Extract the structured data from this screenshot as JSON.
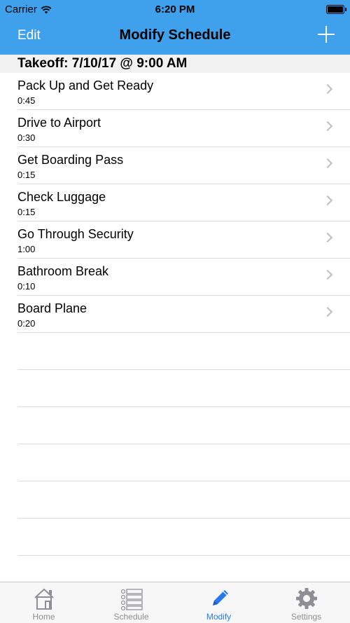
{
  "status": {
    "carrier": "Carrier",
    "time": "6:20 PM"
  },
  "nav": {
    "edit_label": "Edit",
    "title": "Modify Schedule",
    "add_icon": "plus-icon"
  },
  "section": {
    "header": "Takeoff: 7/10/17 @ 9:00 AM"
  },
  "items": [
    {
      "name": "Pack Up and Get Ready",
      "duration": "0:45"
    },
    {
      "name": "Drive to Airport",
      "duration": "0:30"
    },
    {
      "name": "Get Boarding Pass",
      "duration": "0:15"
    },
    {
      "name": "Check Luggage",
      "duration": "0:15"
    },
    {
      "name": "Go Through Security",
      "duration": "1:00"
    },
    {
      "name": "Bathroom Break",
      "duration": "0:10"
    },
    {
      "name": "Board Plane",
      "duration": "0:20"
    }
  ],
  "tabs": [
    {
      "label": "Home",
      "icon": "house-icon"
    },
    {
      "label": "Schedule",
      "icon": "list-icon"
    },
    {
      "label": "Modify",
      "icon": "pencil-icon",
      "active": true
    },
    {
      "label": "Settings",
      "icon": "gear-icon"
    }
  ],
  "colors": {
    "nav_background": "#3fa1ec",
    "active_tab": "#2a79ea",
    "inactive_tab": "#8e8e93"
  }
}
